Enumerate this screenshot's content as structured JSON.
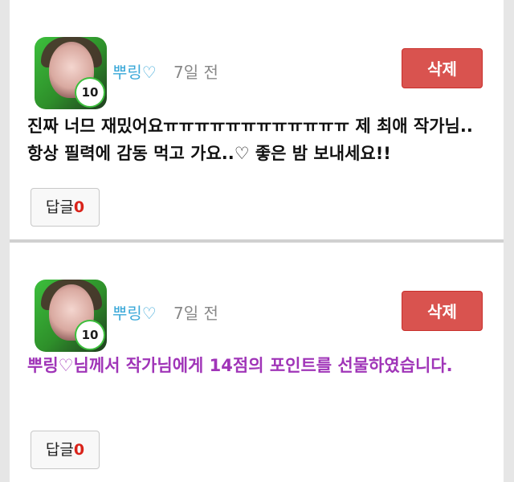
{
  "comments": [
    {
      "username": "뿌링♡",
      "time": "7일 전",
      "level": "10",
      "delete_label": "삭제",
      "text": "진짜 너므 재밌어요ㅠㅠㅠㅠㅠㅠㅠㅠㅠㅠㅠㅠ 제 최애 작가님.. 항상 필력에 감동 먹고 가요..♡ 좋은 밤 보내세요!!",
      "reply_label": "답글",
      "reply_count": "0",
      "text_color": "#111111"
    },
    {
      "username": "뿌링♡",
      "time": "7일 전",
      "level": "10",
      "delete_label": "삭제",
      "text": "뿌링♡님께서 작가님에게 14점의 포인트를 선물하였습니다.",
      "reply_label": "답글",
      "reply_count": "0",
      "text_color": "#a035b8"
    }
  ],
  "colors": {
    "username": "#3aa8d8",
    "delete_button": "#d9534f",
    "reply_count": "#d9231a",
    "gift_text": "#a035b8"
  }
}
